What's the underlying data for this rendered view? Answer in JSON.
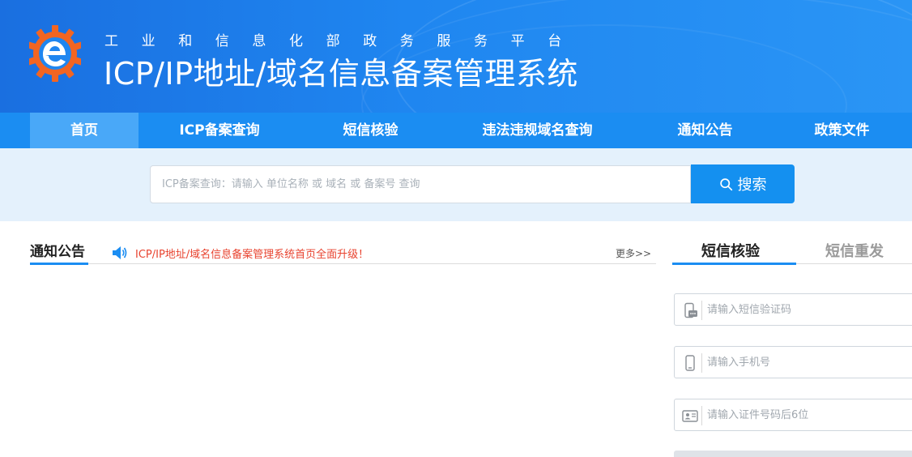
{
  "header": {
    "ministry": "工业和信息化部政务服务平台",
    "system_title": "ICP/IP地址/域名信息备案管理系统",
    "logo_icon": "e-gear-logo",
    "colors": {
      "header_blue": "#1f86f0",
      "nav_blue": "#1b8df2",
      "nav_active": "#49a8f8",
      "logo_orange": "#f26522"
    }
  },
  "nav": {
    "items": [
      {
        "label": "首页",
        "active": true
      },
      {
        "label": "ICP备案查询",
        "active": false
      },
      {
        "label": "短信核验",
        "active": false
      },
      {
        "label": "违法违规域名查询",
        "active": false
      },
      {
        "label": "通知公告",
        "active": false
      },
      {
        "label": "政策文件",
        "active": false
      }
    ]
  },
  "search": {
    "placeholder": "ICP备案查询：请输入 单位名称 或 域名 或 备案号 查询",
    "button_label": "搜索",
    "button_icon": "search-icon"
  },
  "notice": {
    "title": "通知公告",
    "icon": "speaker-icon",
    "headline": "ICP/IP地址/域名信息备案管理系统首页全面升级！",
    "more_label": "更多>>",
    "headline_color": "#e8432f"
  },
  "sms_panel": {
    "tabs": [
      {
        "label": "短信核验",
        "active": true
      },
      {
        "label": "短信重发",
        "active": false
      }
    ],
    "fields": [
      {
        "placeholder": "请输入短信验证码",
        "icon": "sms-message-icon"
      },
      {
        "placeholder": "请输入手机号",
        "icon": "mobile-phone-icon"
      },
      {
        "placeholder": "请输入证件号码后6位",
        "icon": "id-card-icon"
      }
    ]
  }
}
